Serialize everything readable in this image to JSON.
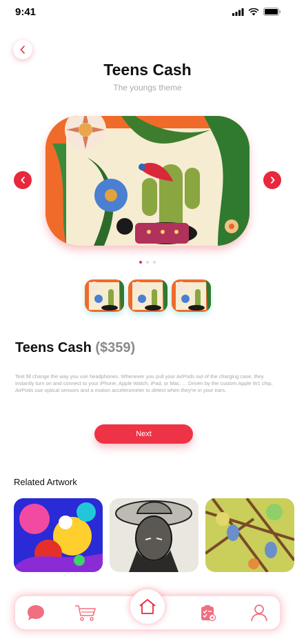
{
  "status": {
    "time": "9:41"
  },
  "header": {
    "title": "Teens Cash",
    "subtitle": "The youngs theme"
  },
  "product": {
    "name": "Teens Cash",
    "price": "($359)",
    "description": "Text fill  change the way you use headphones. Whenever you pull your AirPods out of the charging case, they instantly turn on and connect to your iPhone, Apple Watch, iPad, or Mac. ... Driven by the custom Apple W1 chip, AirPods use optical sensors and a motion accelerometer to detect when they're in your ears."
  },
  "carousel": {
    "active_index": 0,
    "dot_count": 3
  },
  "actions": {
    "next_label": "Next"
  },
  "related": {
    "title": "Related Artwork"
  },
  "icons": {
    "back": "chevron-left-icon",
    "prev": "chevron-left-icon",
    "next": "chevron-right-icon",
    "tabs": [
      "chat-icon",
      "cart-icon",
      "home-icon",
      "checklist-icon",
      "user-icon"
    ]
  },
  "colors": {
    "accent": "#ee3347",
    "tab_icon": "#f07080"
  }
}
